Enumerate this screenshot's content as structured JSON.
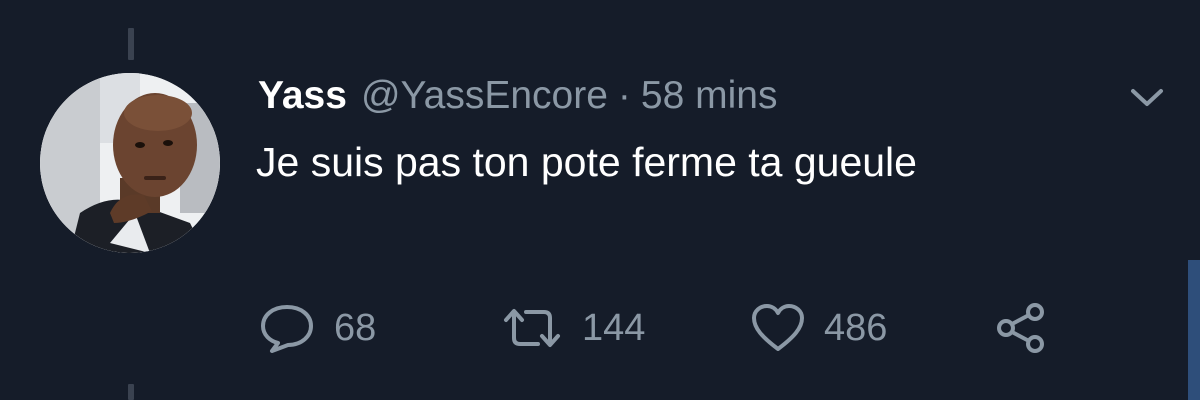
{
  "tweet": {
    "display_name": "Yass",
    "handle": "@YassEncore",
    "separator": "·",
    "timestamp": "58 mins",
    "text": "Je suis pas ton pote ferme ta gueule"
  },
  "actions": {
    "reply": {
      "icon": "reply-icon",
      "count": "68"
    },
    "retweet": {
      "icon": "retweet-icon",
      "count": "144"
    },
    "like": {
      "icon": "heart-icon",
      "count": "486"
    },
    "share": {
      "icon": "share-icon"
    }
  },
  "menu": {
    "icon": "chevron-down-icon"
  },
  "colors": {
    "background": "#151c29",
    "primary_text": "#ffffff",
    "secondary_text": "#8b98a5",
    "thread_line": "#3a4250"
  }
}
